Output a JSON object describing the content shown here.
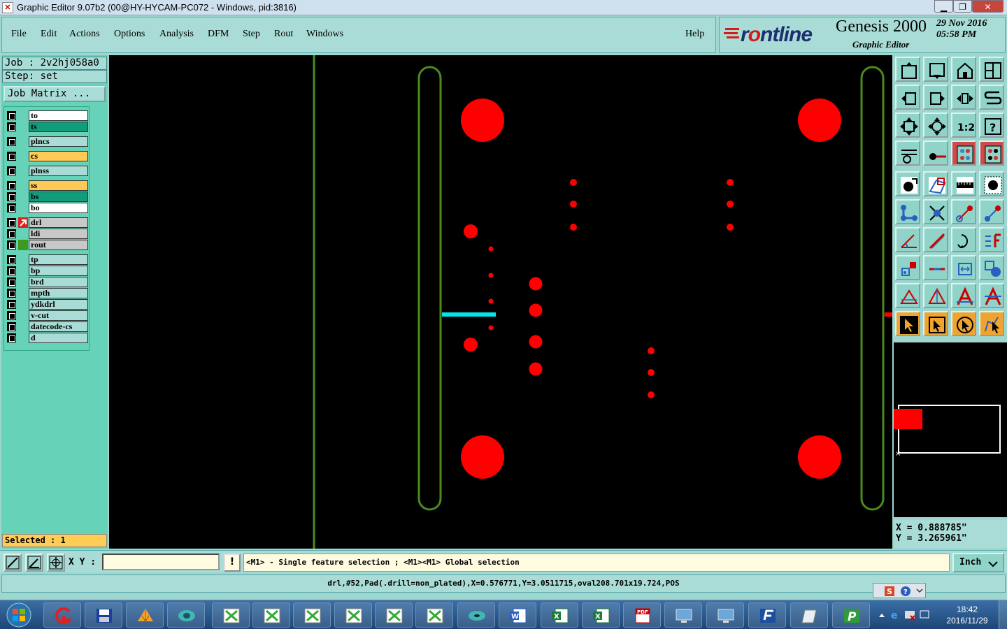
{
  "window": {
    "title": "Graphic Editor 9.07b2 (00@HY-HYCAM-PC072 - Windows, pid:3816)",
    "app_icon": "app-x-icon",
    "min_glyph": "▁",
    "max_glyph": "❐",
    "close_glyph": "✕"
  },
  "menu": {
    "file": "File",
    "edit": "Edit",
    "actions": "Actions",
    "options": "Options",
    "analysis": "Analysis",
    "dfm": "DFM",
    "step": "Step",
    "rout": "Rout",
    "windows": "Windows",
    "help": "Help"
  },
  "brand": {
    "logo_prefix": "F",
    "logo_rest": "r",
    "logo_mid": "ntline",
    "product": "Genesis 2000",
    "subtitle": "Graphic Editor",
    "date": "29 Nov 2016",
    "time": "05:58 PM"
  },
  "job": {
    "job_label": "Job : 2v2hj058a0",
    "step_label": "Step: set",
    "matrix_button": "Job Matrix ..."
  },
  "layers": [
    {
      "name": "to",
      "color": "#ffffff",
      "mark": ""
    },
    {
      "name": "ts",
      "color": "#119c7a",
      "mark": ""
    },
    {
      "name": "plncs",
      "color": "#a9dcd6",
      "mark": ""
    },
    {
      "name": "cs",
      "color": "#ffc955",
      "mark": ""
    },
    {
      "name": "plnss",
      "color": "#a9dcd6",
      "mark": ""
    },
    {
      "name": "ss",
      "color": "#ffc955",
      "mark": ""
    },
    {
      "name": "bs",
      "color": "#119c7a",
      "mark": ""
    },
    {
      "name": "bo",
      "color": "#ffffff",
      "mark": ""
    },
    {
      "name": "drl",
      "color": "#c8c8c8",
      "mark": "#e02020"
    },
    {
      "name": "ldi",
      "color": "#c8c8c8",
      "mark": ""
    },
    {
      "name": "rout",
      "color": "#c8c8c8",
      "mark": "#3d9a1e"
    },
    {
      "name": "tp",
      "color": "#a9dcd6",
      "mark": ""
    },
    {
      "name": "bp",
      "color": "#a9dcd6",
      "mark": ""
    },
    {
      "name": "brd",
      "color": "#a9dcd6",
      "mark": ""
    },
    {
      "name": "mpth",
      "color": "#a9dcd6",
      "mark": ""
    },
    {
      "name": "ydkdrl",
      "color": "#a9dcd6",
      "mark": ""
    },
    {
      "name": "v-cut",
      "color": "#a9dcd6",
      "mark": ""
    },
    {
      "name": "datecode-cs",
      "color": "#a9dcd6",
      "mark": ""
    },
    {
      "name": "d",
      "color": "#a9dcd6",
      "mark": ""
    }
  ],
  "selection": {
    "label": "Selected : 1"
  },
  "coords": {
    "x": "X = 0.888785\"",
    "y": "Y = 3.265961\""
  },
  "cmd": {
    "xy_label": "X Y :",
    "xy_value": "",
    "warn": "!",
    "hint": "<M1> - Single feature selection ; <M1><M1> Global selection",
    "unit": "Inch"
  },
  "status": {
    "text": "drl,#52,Pad(.drill=non_plated),X=0.576771,Y=3.0511715,oval208.701x19.724,POS"
  },
  "taskbar": {
    "clock_time": "18:42",
    "clock_date": "2016/11/29"
  },
  "colors": {
    "canvas": "#000000",
    "pad": "#ff0000",
    "rout": "#4b8b1c",
    "selected": "#00e5ee",
    "panel": "#a9dcd6"
  }
}
